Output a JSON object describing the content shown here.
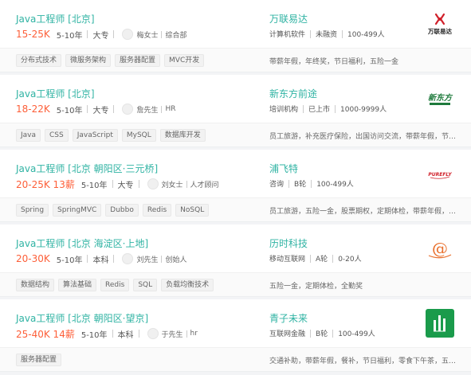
{
  "jobs": [
    {
      "title": "Java工程师  [北京]",
      "salary": "15-25K",
      "experience": "5-10年",
      "education": "大专",
      "contact_name": "梅女士",
      "contact_role": "综合部",
      "company": "万联易达",
      "company_info": [
        "计算机软件",
        "未融资",
        "100-499人"
      ],
      "logo_text": "万联易达",
      "tags": [
        "分布式技术",
        "微服务架构",
        "服务器配置",
        "MVC开发"
      ],
      "benefits": "带薪年假，年终奖，节日福利，五险一金"
    },
    {
      "title": "Java工程师  [北京]",
      "salary": "18-22K",
      "experience": "5-10年",
      "education": "大专",
      "contact_name": "詹先生",
      "contact_role": "HR",
      "company": "新东方前途",
      "company_info": [
        "培训机构",
        "已上市",
        "1000-9999人"
      ],
      "logo_text": "新东方",
      "tags": [
        "Java",
        "CSS",
        "JavaScript",
        "MySQL",
        "数据库开发"
      ],
      "benefits": "员工旅游，补充医疗保险，出国访问交流，带薪年假，节…"
    },
    {
      "title": "Java工程师  [北京 朝阳区·三元桥]",
      "salary": "20-25K 13薪",
      "experience": "5-10年",
      "education": "大专",
      "contact_name": "刘女士",
      "contact_role": "人才顾问",
      "company": "浦飞特",
      "company_info": [
        "咨询",
        "B轮",
        "100-499人"
      ],
      "logo_text": "PUREFLY",
      "tags": [
        "Spring",
        "SpringMVC",
        "Dubbo",
        "Redis",
        "NoSQL"
      ],
      "benefits": "员工旅游，五险一金，股票期权，定期体检，带薪年假，…"
    },
    {
      "title": "Java工程师  [北京 海淀区·上地]",
      "salary": "20-30K",
      "experience": "5-10年",
      "education": "本科",
      "contact_name": "刘先生",
      "contact_role": "创始人",
      "company": "历时科技",
      "company_info": [
        "移动互联网",
        "A轮",
        "0-20人"
      ],
      "logo_text": "@",
      "tags": [
        "数据结构",
        "算法基础",
        "Redis",
        "SQL",
        "负载均衡技术"
      ],
      "benefits": "五险一金，定期体检，全勤奖"
    },
    {
      "title": "Java工程师  [北京 朝阳区·望京]",
      "salary": "25-40K 14薪",
      "experience": "5-10年",
      "education": "本科",
      "contact_name": "于先生",
      "contact_role": "hr",
      "company": "青子未来",
      "company_info": [
        "互联网金融",
        "B轮",
        "100-499人"
      ],
      "logo_text": "",
      "tags": [
        "服务器配置"
      ],
      "benefits": "交通补助，带薪年假，餐补，节日福利，零食下午茶，五…"
    }
  ],
  "colors": {
    "accent": "#2fb3a3",
    "salary": "#fd5f39",
    "logo_red": "#d0202a",
    "logo_green": "#1e7a3c",
    "logo_orange": "#e96e2a",
    "logo_qingzi": "#1a9b4b"
  },
  "logo_icons": [
    "wanlian-logo-icon",
    "xindongfang-logo-icon",
    "purefly-logo-icon",
    "lishi-logo-icon",
    "qingzi-logo-icon"
  ]
}
